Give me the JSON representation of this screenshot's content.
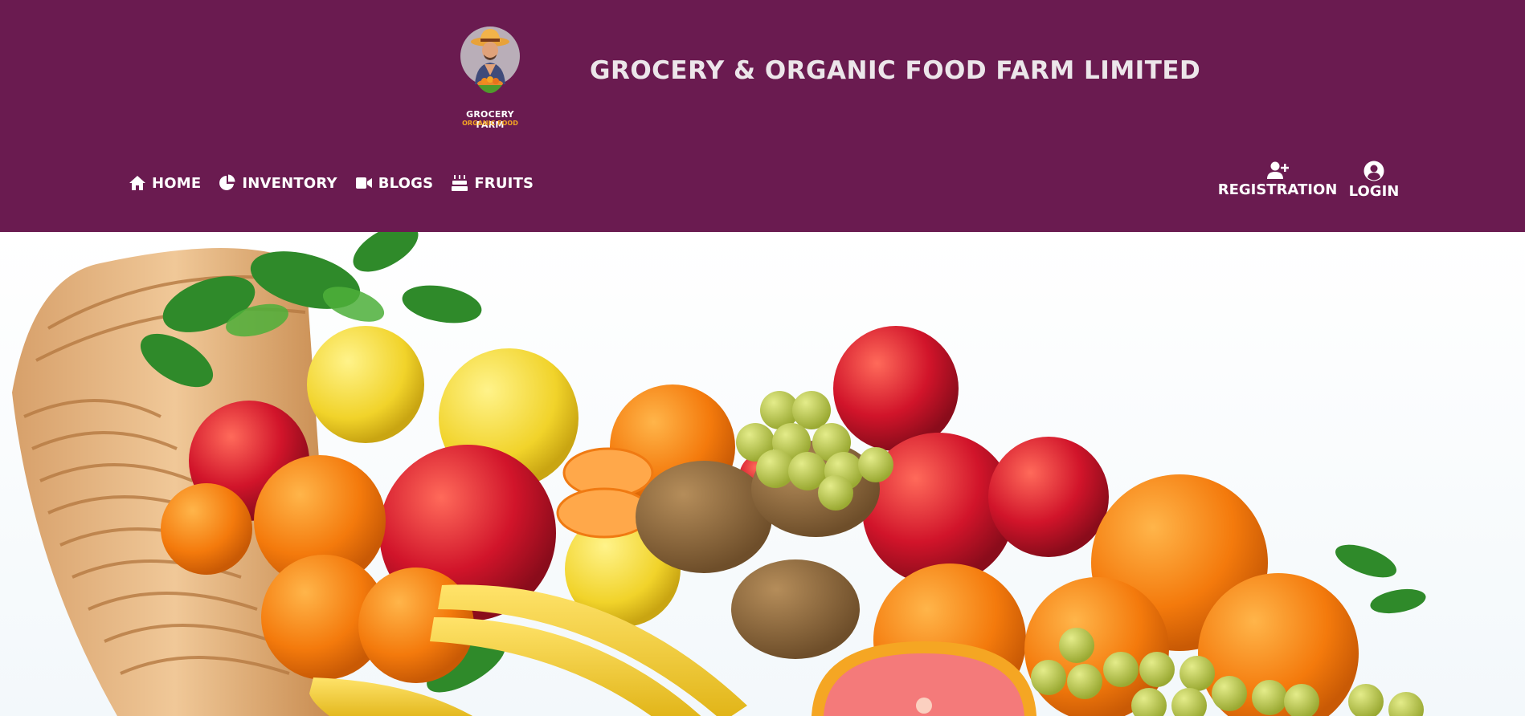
{
  "brand": {
    "logo_line1": "GROCERY FARM",
    "logo_line2": "ORGANIC FOOD",
    "site_title": "GROCERY & ORGANIC FOOD FARM LIMITED"
  },
  "nav": {
    "items": [
      {
        "label": "HOME",
        "icon": "home-icon"
      },
      {
        "label": "INVENTORY",
        "icon": "pie-chart-icon"
      },
      {
        "label": "BLOGS",
        "icon": "video-icon"
      },
      {
        "label": "FRUITS",
        "icon": "cake-icon"
      }
    ]
  },
  "auth": {
    "registration": {
      "label": "REGISTRATION",
      "icon": "user-plus-icon"
    },
    "login": {
      "label": "LOGIN",
      "icon": "user-circle-icon"
    }
  },
  "colors": {
    "header_bg": "#6a1b50",
    "title_text": "#ece6ea",
    "nav_text": "#ffffff",
    "logo_accent": "#f5a623"
  },
  "hero": {
    "image": "fruit-basket-image"
  }
}
